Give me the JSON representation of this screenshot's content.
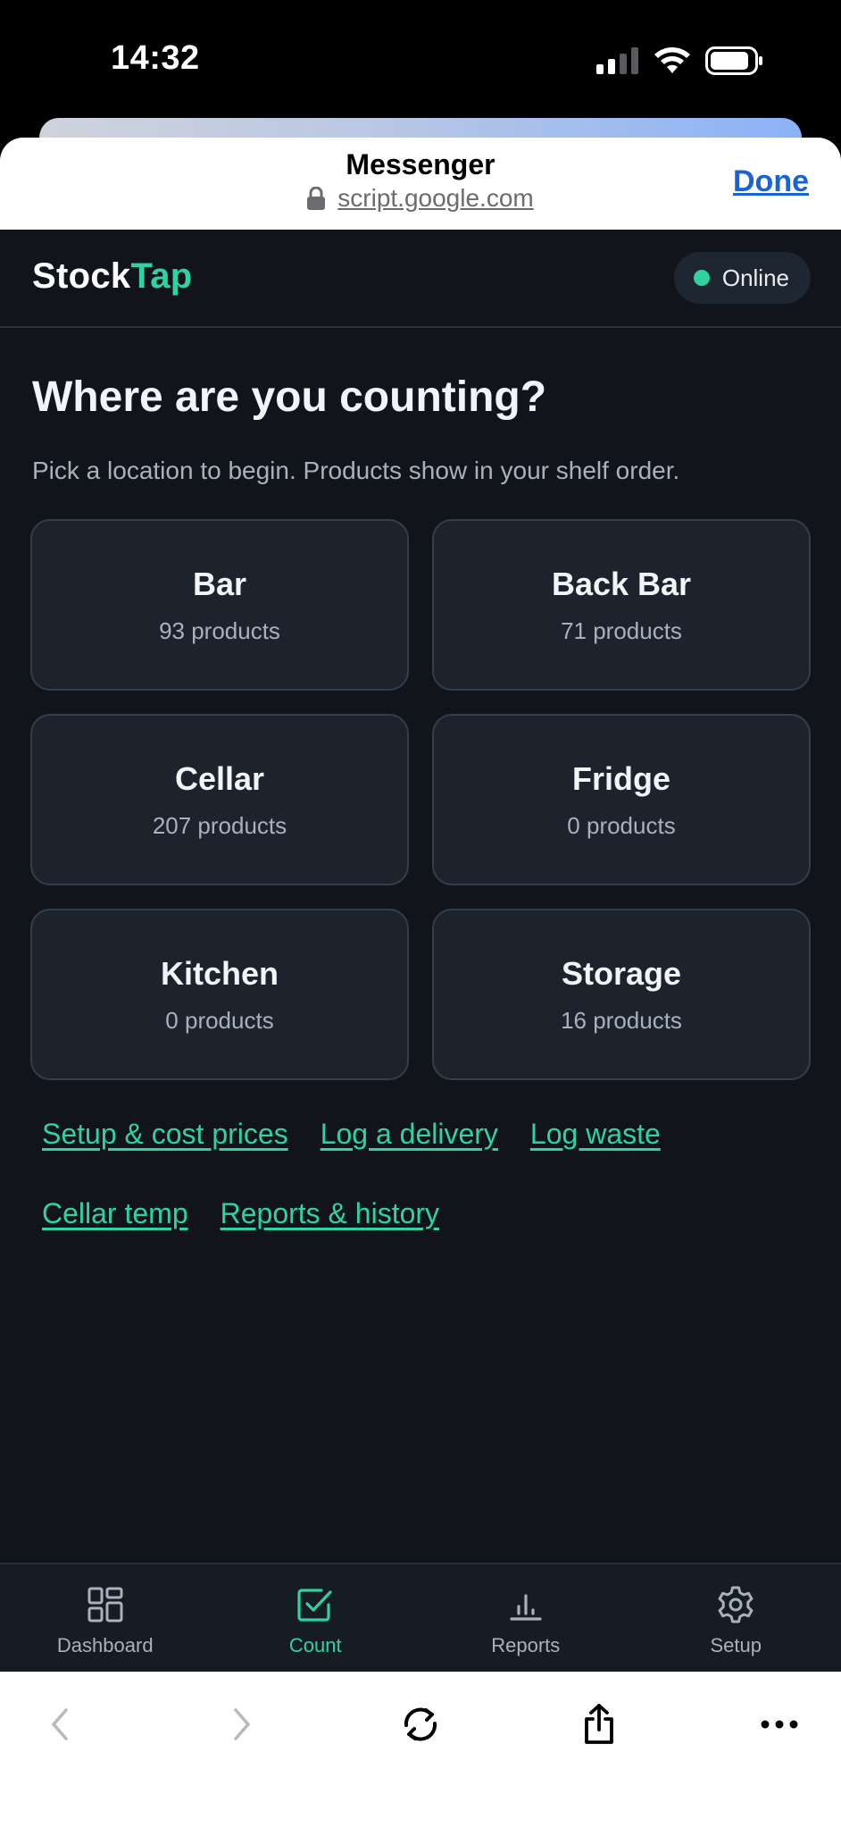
{
  "status_bar": {
    "time": "14:32"
  },
  "browser": {
    "title": "Messenger",
    "url": "script.google.com",
    "done_label": "Done"
  },
  "app": {
    "brand_primary": "Stock",
    "brand_accent": "Tap",
    "status_label": "Online",
    "heading": "Where are you counting?",
    "subtext": "Pick a location to begin. Products show in your shelf order.",
    "locations": [
      {
        "name": "Bar",
        "count": "93 products"
      },
      {
        "name": "Back Bar",
        "count": "71 products"
      },
      {
        "name": "Cellar",
        "count": "207 products"
      },
      {
        "name": "Fridge",
        "count": "0 products"
      },
      {
        "name": "Kitchen",
        "count": "0 products"
      },
      {
        "name": "Storage",
        "count": "16 products"
      }
    ],
    "links": {
      "setup": "Setup & cost prices",
      "delivery": "Log a delivery",
      "waste": "Log waste",
      "cellar_temp": "Cellar temp",
      "reports": "Reports & history"
    },
    "nav": [
      {
        "label": "Dashboard",
        "icon": "grid-icon"
      },
      {
        "label": "Count",
        "icon": "checkbox-icon",
        "active": true
      },
      {
        "label": "Reports",
        "icon": "bar-chart-icon"
      },
      {
        "label": "Setup",
        "icon": "gear-icon"
      }
    ]
  },
  "colors": {
    "background": "#11151b",
    "card": "#1c232d",
    "accent": "#2fd3a0",
    "link_blue": "#1a63d6"
  }
}
